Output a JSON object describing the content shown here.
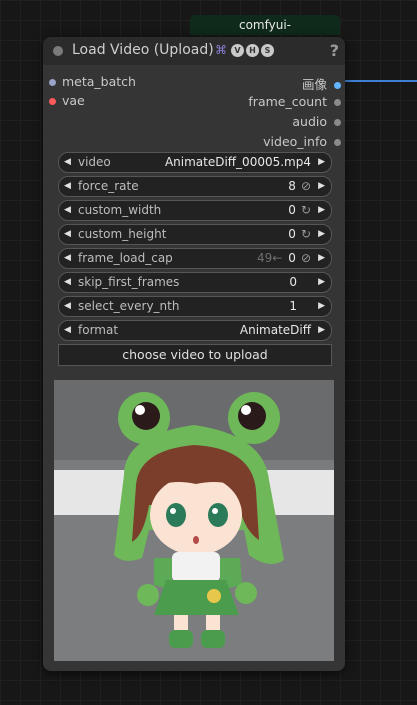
{
  "badge": "comfyui-videohelpersuite",
  "node": {
    "title": "Load Video (Upload)",
    "logo_letters": [
      "V",
      "H",
      "S"
    ],
    "help": "?"
  },
  "inputs": [
    {
      "label": "meta_batch",
      "color": "#9aa3c9"
    },
    {
      "label": "vae",
      "color": "#ff5a5a"
    }
  ],
  "outputs": [
    {
      "label": "画像",
      "color": "#64b5ff"
    },
    {
      "label": "frame_count",
      "color": "#8a8a8a"
    },
    {
      "label": "audio",
      "color": "#8a8a8a"
    },
    {
      "label": "video_info",
      "color": "#8a8a8a"
    }
  ],
  "widgets": [
    {
      "name": "video",
      "value": "AnimateDiff_00005.mp4",
      "extra": "",
      "ghost": ""
    },
    {
      "name": "force_rate",
      "value": "8",
      "extra": "⊘",
      "ghost": ""
    },
    {
      "name": "custom_width",
      "value": "0",
      "extra": "↻",
      "ghost": ""
    },
    {
      "name": "custom_height",
      "value": "0",
      "extra": "↻",
      "ghost": ""
    },
    {
      "name": "frame_load_cap",
      "value": "0",
      "extra": "⊘",
      "ghost": "49←"
    },
    {
      "name": "skip_first_frames",
      "value": "0",
      "extra": "",
      "ghost": ""
    },
    {
      "name": "select_every_nth",
      "value": "1",
      "extra": "",
      "ghost": ""
    },
    {
      "name": "format",
      "value": "AnimateDiff",
      "extra": "",
      "ghost": ""
    }
  ],
  "upload_label": "choose video to upload",
  "colors": {
    "accent_wire": "#3d7fd4",
    "node_bg": "#353535",
    "badge_bg": "#0f2a1b"
  }
}
